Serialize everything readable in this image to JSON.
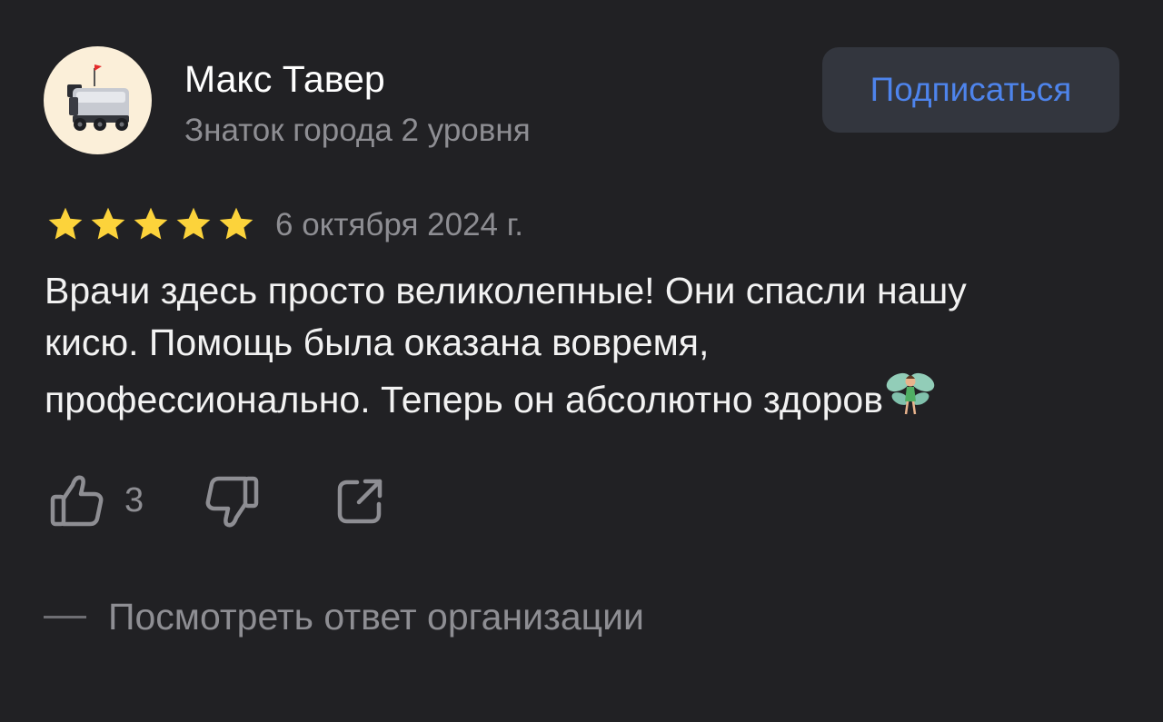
{
  "author": {
    "name": "Макс Тавер",
    "level": "Знаток города 2 уровня",
    "avatar_icon": "delivery-robot-icon"
  },
  "subscribe": {
    "label": "Подписаться",
    "color": "#4e84ec"
  },
  "review": {
    "rating": 5,
    "rating_max": 5,
    "date": "6 октября 2024 г.",
    "text_lines": [
      "Врачи здесь просто великолепные! Они спасли нашу",
      "кисю. Помощь была оказана вовремя,",
      "профессионально. Теперь он абсолютно здоров"
    ],
    "trailing_emoji": "fairy-emoji"
  },
  "actions": {
    "likes": "3",
    "like_icon": "thumbs-up-icon",
    "dislike_icon": "thumbs-down-icon",
    "share_icon": "share-icon"
  },
  "reply": {
    "label": "Посмотреть ответ организации"
  },
  "colors": {
    "background": "#212124",
    "star": "#fcd33b",
    "muted_text": "#8e8e93",
    "button_bg": "#33363e"
  }
}
